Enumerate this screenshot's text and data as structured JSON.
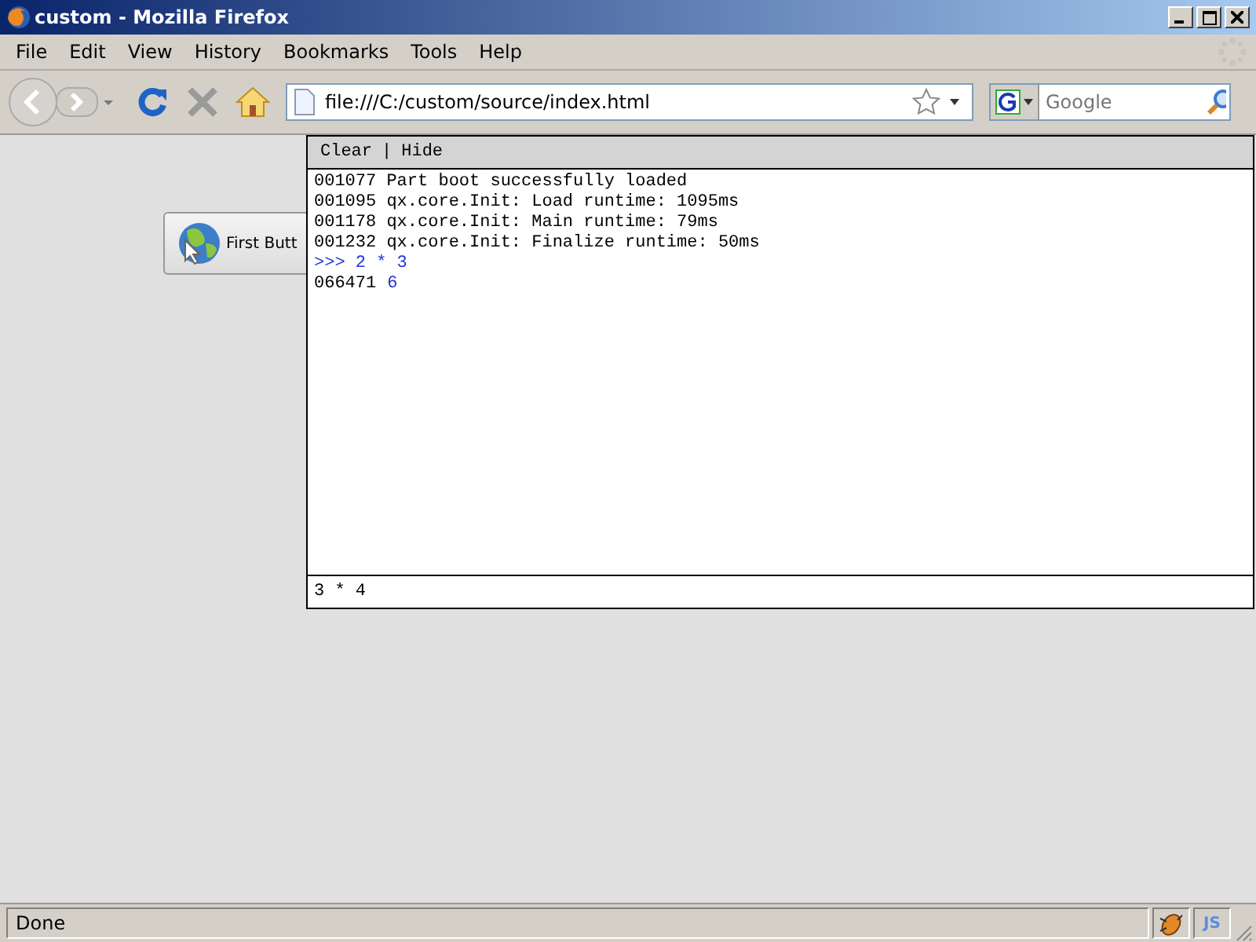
{
  "window": {
    "title": "custom - Mozilla Firefox"
  },
  "menu": [
    "File",
    "Edit",
    "View",
    "History",
    "Bookmarks",
    "Tools",
    "Help"
  ],
  "address": {
    "value": "file:///C:/custom/source/index.html"
  },
  "search": {
    "placeholder": "Google"
  },
  "page": {
    "button": {
      "label": "First Butt"
    }
  },
  "console": {
    "actions": [
      "Clear",
      "|",
      "Hide"
    ],
    "lines": [
      {
        "kind": "log",
        "time": "001077",
        "text": "Part boot successfully loaded"
      },
      {
        "kind": "log",
        "time": "001095",
        "text": "qx.core.Init: Load runtime: 1095ms"
      },
      {
        "kind": "log",
        "time": "001178",
        "text": "qx.core.Init: Main runtime: 79ms"
      },
      {
        "kind": "log",
        "time": "001232",
        "text": "qx.core.Init: Finalize runtime: 50ms"
      },
      {
        "kind": "command",
        "text": ">>> 2 * 3"
      },
      {
        "kind": "result",
        "time": "066471",
        "text": "6"
      }
    ],
    "input": {
      "value": "3 * 4"
    }
  },
  "status_bar": {
    "text": "Done",
    "badge": "JS"
  }
}
